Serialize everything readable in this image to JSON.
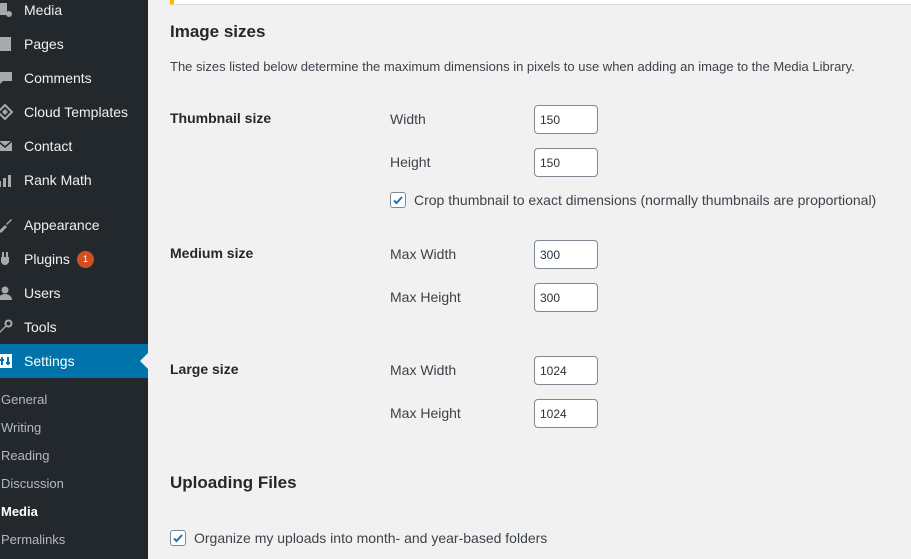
{
  "sidebar": {
    "menu": [
      {
        "label": "Media",
        "icon": "media-icon"
      },
      {
        "label": "Pages",
        "icon": "pages-icon"
      },
      {
        "label": "Comments",
        "icon": "comments-icon"
      },
      {
        "label": "Cloud Templates",
        "icon": "cloud-templates-icon"
      },
      {
        "label": "Contact",
        "icon": "contact-icon"
      },
      {
        "label": "Rank Math",
        "icon": "rank-math-icon"
      },
      {
        "label": "Appearance",
        "icon": "appearance-icon"
      },
      {
        "label": "Plugins",
        "icon": "plugins-icon",
        "badge": "1"
      },
      {
        "label": "Users",
        "icon": "users-icon"
      },
      {
        "label": "Tools",
        "icon": "tools-icon"
      },
      {
        "label": "Settings",
        "icon": "settings-icon",
        "active": true
      }
    ],
    "submenu": [
      {
        "label": "General"
      },
      {
        "label": "Writing"
      },
      {
        "label": "Reading"
      },
      {
        "label": "Discussion"
      },
      {
        "label": "Media",
        "current": true
      },
      {
        "label": "Permalinks"
      }
    ],
    "colors": {
      "background": "#23282d",
      "active": "#0073aa",
      "badge": "#d54e21"
    }
  },
  "main": {
    "image_sizes": {
      "heading": "Image sizes",
      "description": "The sizes listed below determine the maximum dimensions in pixels to use when adding an image to the Media Library.",
      "thumbnail": {
        "label": "Thumbnail size",
        "width_label": "Width",
        "width_value": "150",
        "height_label": "Height",
        "height_value": "150",
        "crop_label": "Crop thumbnail to exact dimensions (normally thumbnails are proportional)",
        "crop_checked": true
      },
      "medium": {
        "label": "Medium size",
        "width_label": "Max Width",
        "width_value": "300",
        "height_label": "Max Height",
        "height_value": "300"
      },
      "large": {
        "label": "Large size",
        "width_label": "Max Width",
        "width_value": "1024",
        "height_label": "Max Height",
        "height_value": "1024"
      }
    },
    "uploading": {
      "heading": "Uploading Files",
      "organize_label": "Organize my uploads into month- and year-based folders",
      "organize_checked": true
    }
  }
}
